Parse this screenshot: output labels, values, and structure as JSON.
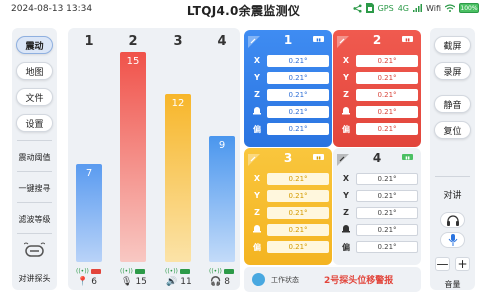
{
  "header": {
    "datetime": "2024-08-13  13:34",
    "title": "LTQJ4.0余震监测仪",
    "gps": "GPS",
    "network": "4G",
    "wifi": "Wifi",
    "battery": "100%"
  },
  "left_sidebar": {
    "buttons": [
      "震动",
      "地图",
      "文件",
      "设置"
    ],
    "actions": [
      "震动阈值",
      "一键搜寻",
      "滤波等级"
    ],
    "walkie": "对讲探头"
  },
  "bars": [
    {
      "label": "1",
      "value": "7",
      "count": "6",
      "color_top": "#5a9bf0",
      "color_bottom": "#b9d3f8",
      "signal_color": "#e2453b"
    },
    {
      "label": "2",
      "value": "15",
      "count": "15",
      "color_top": "#f0524a",
      "color_bottom": "#f8c8c3",
      "signal_color": "#2c9a48"
    },
    {
      "label": "3",
      "value": "12",
      "count": "11",
      "color_top": "#f7b62a",
      "color_bottom": "#fbe3a8",
      "signal_color": "#2c9a48"
    },
    {
      "label": "4",
      "value": "9",
      "count": "8",
      "color_top": "#4a96ee",
      "color_bottom": "#c3dbf9",
      "signal_color": "#2c9a48"
    }
  ],
  "probes": [
    {
      "num": "1",
      "rows": [
        {
          "label": "X",
          "value": "0.21°"
        },
        {
          "label": "Y",
          "value": "0.21°"
        },
        {
          "label": "Z",
          "value": "0.21°"
        },
        {
          "label": "",
          "value": "0.21°"
        },
        {
          "label": "偏",
          "value": "0.21°"
        }
      ]
    },
    {
      "num": "2",
      "rows": [
        {
          "label": "X",
          "value": "0.21°"
        },
        {
          "label": "Y",
          "value": "0.21°"
        },
        {
          "label": "Z",
          "value": "0.21°"
        },
        {
          "label": "",
          "value": "0.21°"
        },
        {
          "label": "偏",
          "value": "0.21°"
        }
      ]
    },
    {
      "num": "3",
      "rows": [
        {
          "label": "X",
          "value": "0.21°"
        },
        {
          "label": "Y",
          "value": "0.21°"
        },
        {
          "label": "Z",
          "value": "0.21°"
        },
        {
          "label": "",
          "value": "0.21°"
        },
        {
          "label": "偏",
          "value": "0.21°"
        }
      ]
    },
    {
      "num": "4",
      "rows": [
        {
          "label": "X",
          "value": "0.21°"
        },
        {
          "label": "Y",
          "value": "0.21°"
        },
        {
          "label": "Z",
          "value": "0.21°"
        },
        {
          "label": "",
          "value": "0.21°"
        },
        {
          "label": "偏",
          "value": "0.21°"
        }
      ]
    }
  ],
  "status": {
    "label": "工作状态",
    "message": "2号探头位移警报"
  },
  "right_sidebar": {
    "buttons": [
      "截屏",
      "录屏",
      "静音",
      "复位"
    ],
    "intercom": "对讲",
    "volume_label": "音量",
    "minus": "—",
    "plus": "+"
  }
}
